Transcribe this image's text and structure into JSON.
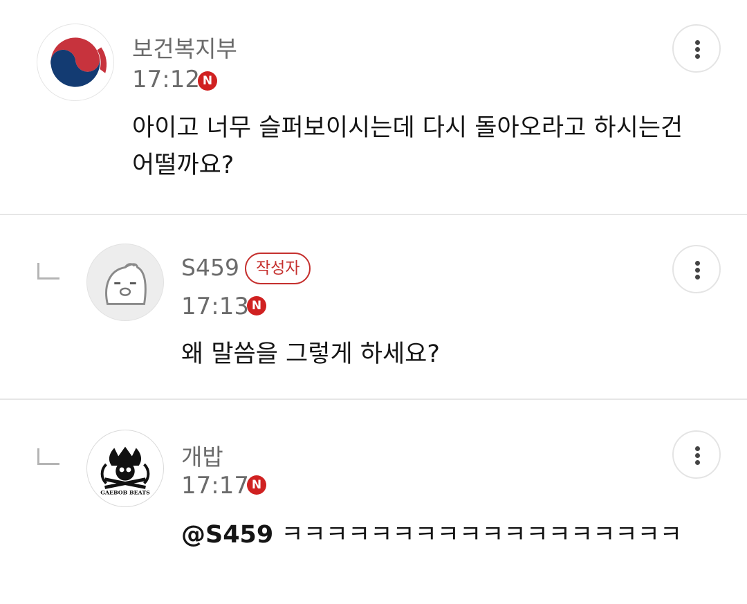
{
  "comments": [
    {
      "author": "보건복지부",
      "time": "17:12",
      "new_label": "N",
      "text": "아이고 너무 슬퍼보이시는데 다시 돌아오라고 하시는건 어떨까요?"
    },
    {
      "author": "S459",
      "author_badge": "작성자",
      "time": "17:13",
      "new_label": "N",
      "text": "왜 말씀을 그렇게 하세요?"
    },
    {
      "author": "개밥",
      "time": "17:17",
      "new_label": "N",
      "mention": "@S459",
      "text": " ㅋㅋㅋㅋㅋㅋㅋㅋㅋㅋㅋㅋㅋㅋㅋㅋㅋㅋ",
      "avatar_text": "GAEBOB BEATS"
    }
  ],
  "colors": {
    "accent_red": "#c5302e",
    "new_badge": "#d02121",
    "muted_text": "#6b6b6b"
  },
  "icons": {
    "more": "more-vertical-icon",
    "reply": "reply-arrow-icon",
    "new": "new-badge-icon"
  }
}
